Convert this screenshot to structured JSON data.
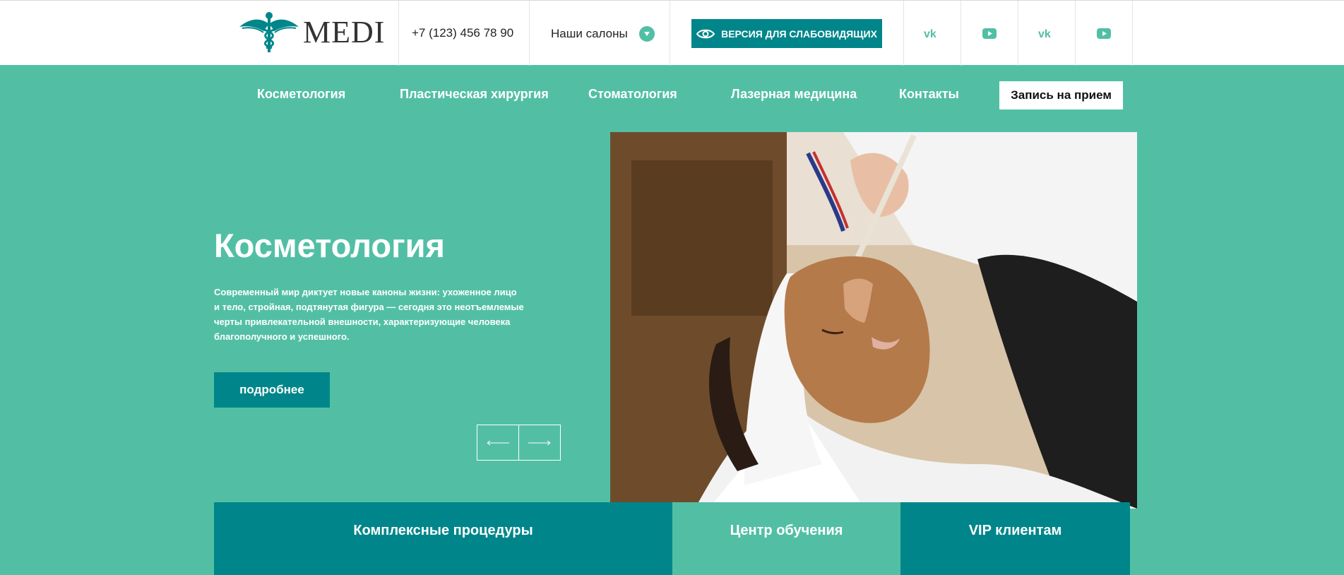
{
  "header": {
    "logo_text": "MEDI",
    "phone": "+7 (123) 456 78 90",
    "salons_label": "Наши салоны",
    "accessibility_label": "ВЕРСИЯ ДЛЯ СЛАБОВИДЯЩИХ",
    "socials": [
      "vk-icon",
      "youtube-icon",
      "vk-icon",
      "youtube-icon"
    ]
  },
  "nav": {
    "items": [
      "Косметология",
      "Пластическая хирургия",
      "Стоматология",
      "Лазерная медицина",
      "Контакты"
    ],
    "cta_label": "Запись на прием"
  },
  "hero": {
    "title": "Косметология",
    "text": "Современный мир диктует новые каноны жизни: ухоженное лицо и тело, стройная, подтянутая фигура — сегодня это неотъемлемые черты привлекательной внешности, характеризующие человека благополучного и успешного.",
    "more_label": "подробнее",
    "prev_icon": "arrow-left-icon",
    "next_icon": "arrow-right-icon"
  },
  "tabs": [
    "Комплексные процедуры",
    "Центр обучения",
    "VIP клиентам"
  ],
  "colors": {
    "background": "#52bfa5",
    "accent": "#00868a",
    "header_bg": "#ffffff"
  }
}
